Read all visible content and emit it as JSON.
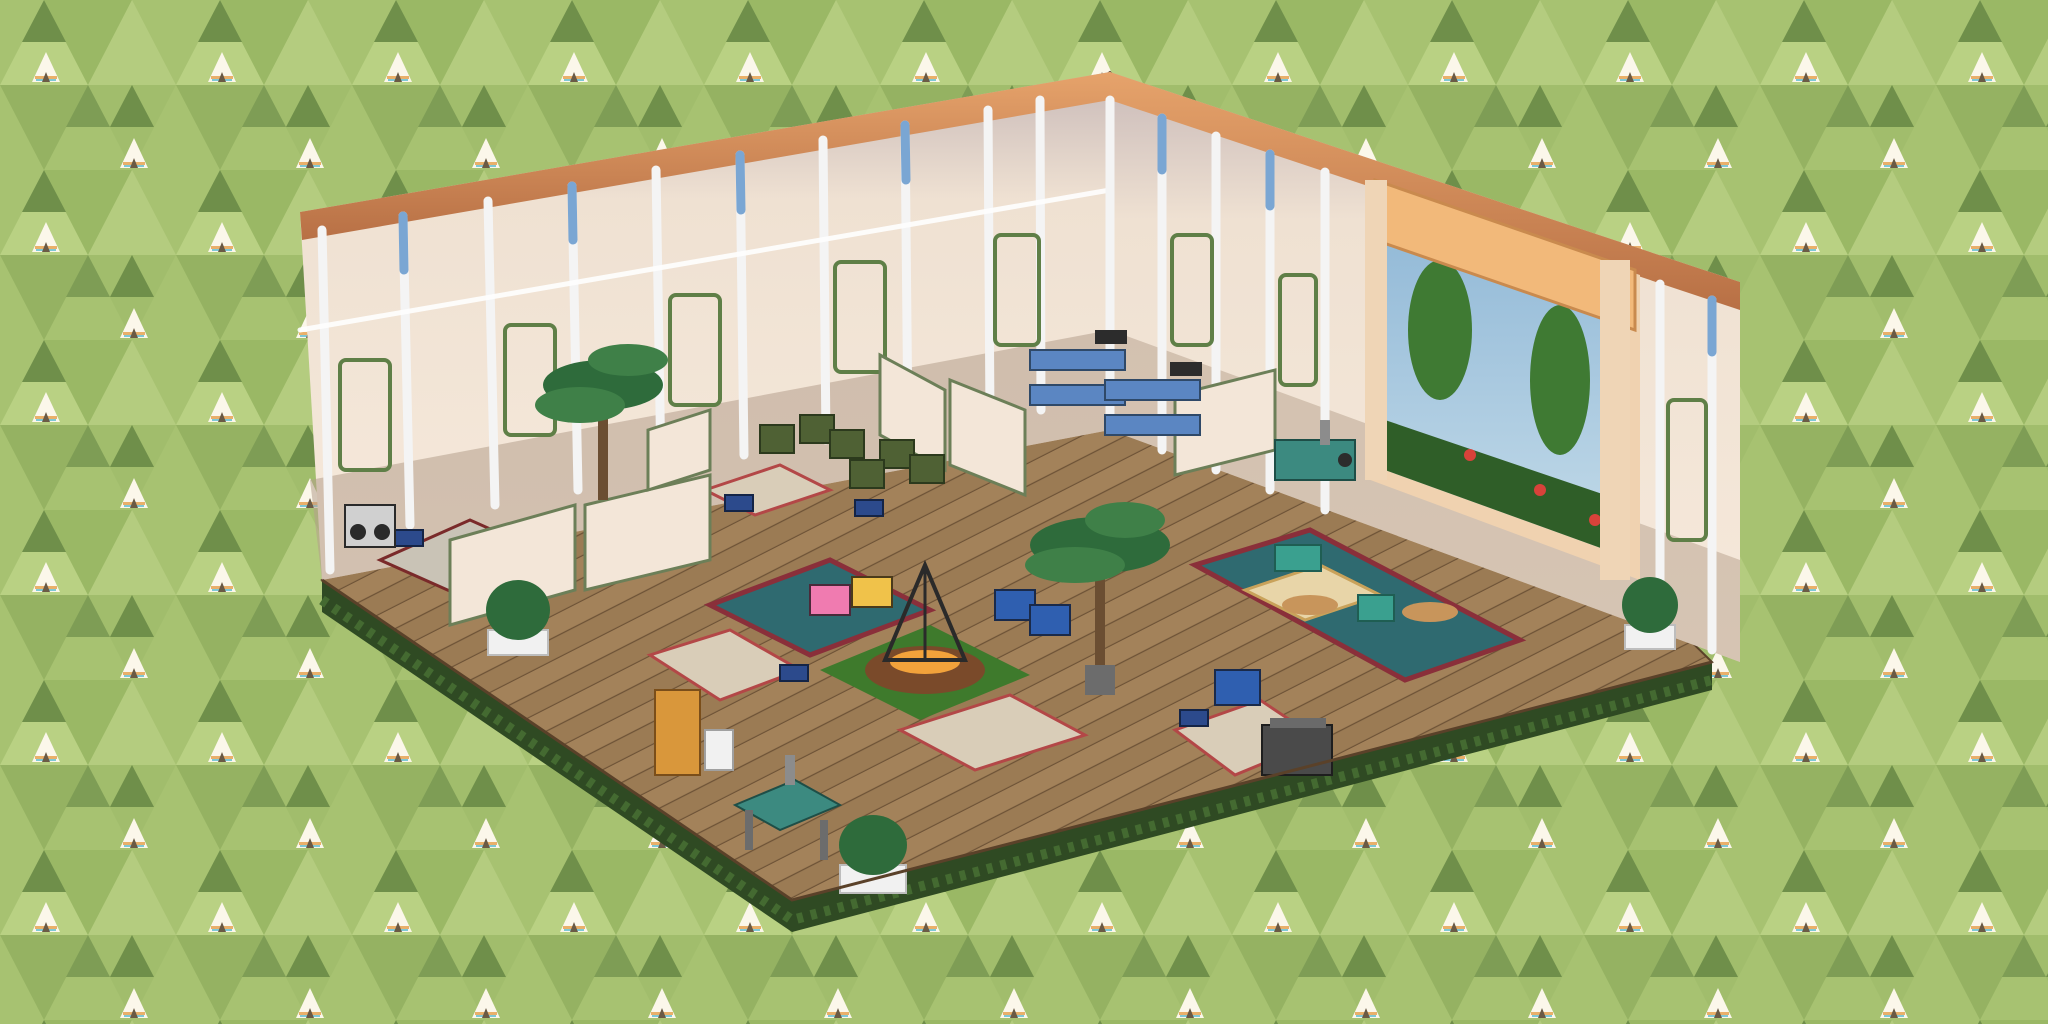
{
  "scene": {
    "type": "isometric-room",
    "theme": "indoor camping tent room",
    "background": {
      "pattern": "teepee-triangles",
      "colors": {
        "base": "#a7c271",
        "triangle_light": "#b9d183",
        "triangle_mid": "#8fab5c",
        "triangle_dark": "#6f8f4a",
        "teepee_body": "#fbf7ea",
        "teepee_stripe_a": "#e9b06a",
        "teepee_stripe_b": "#7fc7d6"
      }
    },
    "room": {
      "colors": {
        "wall_top_trim": "#c8834f",
        "wall_top_highlight": "#e6a36b",
        "wall_fabric": "#f2e3d1",
        "wall_fabric_shadow": "#d9c7b6",
        "wall_base": "#b59f8c",
        "pole_white": "#f4f4f4",
        "pole_blue": "#7aa6d3",
        "pole_joint": "#4a5a40",
        "panel_green": "#5f7f47",
        "floor_plank": "#9b7b54",
        "floor_plank_dark": "#7e6142",
        "floor_line": "#6d5236",
        "hedge": "#2f4a23",
        "hedge_light": "#446a31"
      },
      "window": {
        "frame": "#f0d2b0",
        "shade": "#f2b97a",
        "sky": "#9fc3dc",
        "foliage": "#3f7a33"
      }
    },
    "props": [
      {
        "name": "boombox",
        "icon": "boombox-icon"
      },
      {
        "name": "palm-tree-left",
        "icon": "palm-tree-icon"
      },
      {
        "name": "palm-tree-center",
        "icon": "palm-tree-icon"
      },
      {
        "name": "bunk-beds",
        "icon": "bunk-bed-icon"
      },
      {
        "name": "campfire-teepee",
        "icon": "campfire-icon"
      },
      {
        "name": "camp-chairs",
        "icon": "camp-chair-icon"
      },
      {
        "name": "storage-crates",
        "icon": "crate-icon"
      },
      {
        "name": "camp-kitchen-left",
        "icon": "kitchen-counter-icon"
      },
      {
        "name": "camp-kitchen-right",
        "icon": "kitchen-counter-icon"
      },
      {
        "name": "picnic-blanket",
        "icon": "picnic-blanket-icon"
      },
      {
        "name": "patterned-rugs",
        "icon": "rug-icon"
      },
      {
        "name": "potted-shrubs",
        "icon": "shrub-icon"
      },
      {
        "name": "folding-stools",
        "icon": "stool-icon"
      },
      {
        "name": "wooden-chair",
        "icon": "chair-icon"
      },
      {
        "name": "cooler",
        "icon": "cooler-icon"
      }
    ]
  }
}
